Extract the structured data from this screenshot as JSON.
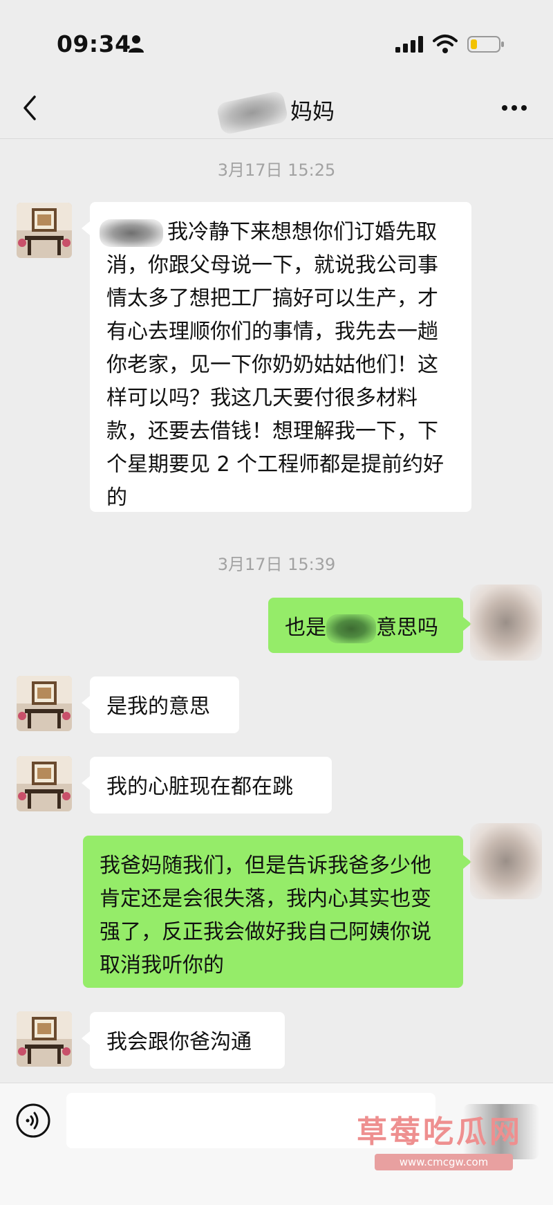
{
  "status_bar": {
    "time": "09:34"
  },
  "nav": {
    "title": "妈妈",
    "back_icon": "chevron-left-icon",
    "more_icon": "more-dots-icon"
  },
  "messages": {
    "time_1": "3月17日 15:25",
    "msg_1": "我冷静下来想想你们订婚先取消，你跟父母说一下，就说我公司事情太多了想把工厂搞好可以生产，才有心去理顺你们的事情，我先去一趟你老家，见一下你奶奶姑姑他们！这样可以吗？我这几天要付很多材料款，还要去借钱！想理解我一下，下个星期要见 2 个工程师都是提前约好的",
    "time_2": "3月17日 15:39",
    "msg_2_before": "也是",
    "msg_2_after": "意思吗",
    "msg_3": "是我的意思",
    "msg_4": "我的心脏现在都在跳",
    "msg_5": "我爸妈随我们，但是告诉我爸多少他肯定还是会很失落，我内心其实也变强了，反正我会做好我自己阿姨你说取消我听你的",
    "msg_6": "我会跟你爸沟通"
  },
  "input_bar": {
    "voice_icon": "voice-icon",
    "watermark_text": "草莓吃瓜网",
    "watermark_url": "www.cmcgw.com"
  },
  "colors": {
    "background": "#ededed",
    "bubble_sent": "#95ec69",
    "bubble_received": "#ffffff",
    "timestamp": "#a2a2a2",
    "watermark": "#ee8f8f"
  }
}
